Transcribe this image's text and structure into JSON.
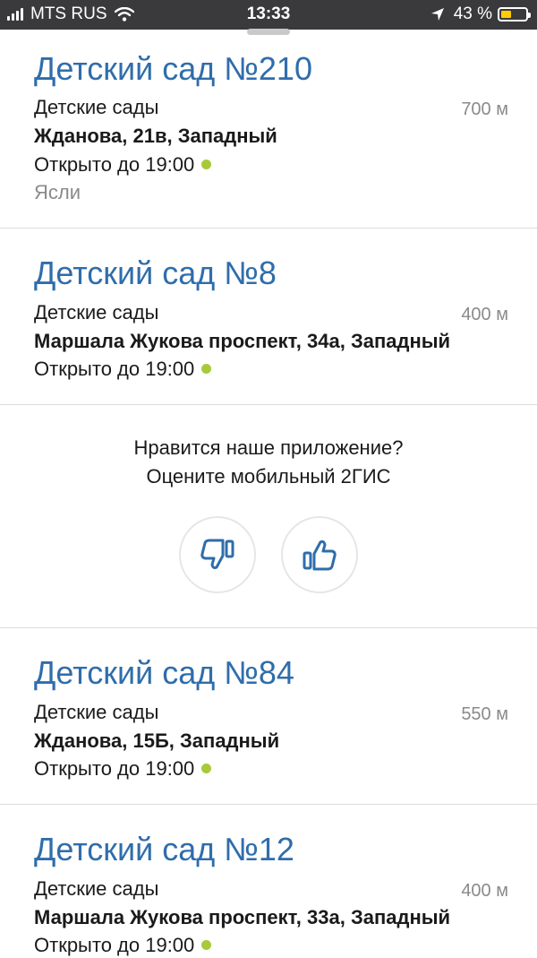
{
  "status_bar": {
    "carrier": "MTS RUS",
    "time": "13:33",
    "battery_percent": "43 %",
    "battery_level": 0.43
  },
  "results": [
    {
      "title": "Детский сад №210",
      "category": "Детские сады",
      "distance": "700 м",
      "address": "Жданова, 21в, Западный",
      "hours": "Открыто до 19:00",
      "extra": "Ясли"
    },
    {
      "title": "Детский сад №8",
      "category": "Детские сады",
      "distance": "400 м",
      "address": "Маршала Жукова проспект, 34а, Западный",
      "hours": "Открыто до 19:00"
    },
    {
      "title": "Детский сад №84",
      "category": "Детские сады",
      "distance": "550 м",
      "address": "Жданова, 15Б, Западный",
      "hours": "Открыто до 19:00"
    },
    {
      "title": "Детский сад №12",
      "category": "Детские сады",
      "distance": "400 м",
      "address": "Маршала Жукова проспект, 33а, Западный",
      "hours": "Открыто до 19:00"
    }
  ],
  "rating_prompt": {
    "question": "Нравится наше приложение?",
    "subtitle": "Оцените мобильный 2ГИС",
    "dislike_icon": "thumbs-down-icon",
    "like_icon": "thumbs-up-icon"
  },
  "colors": {
    "title_blue": "#2f6dab",
    "open_green": "#a8c93a",
    "status_bar_bg": "#3a3a3c"
  }
}
